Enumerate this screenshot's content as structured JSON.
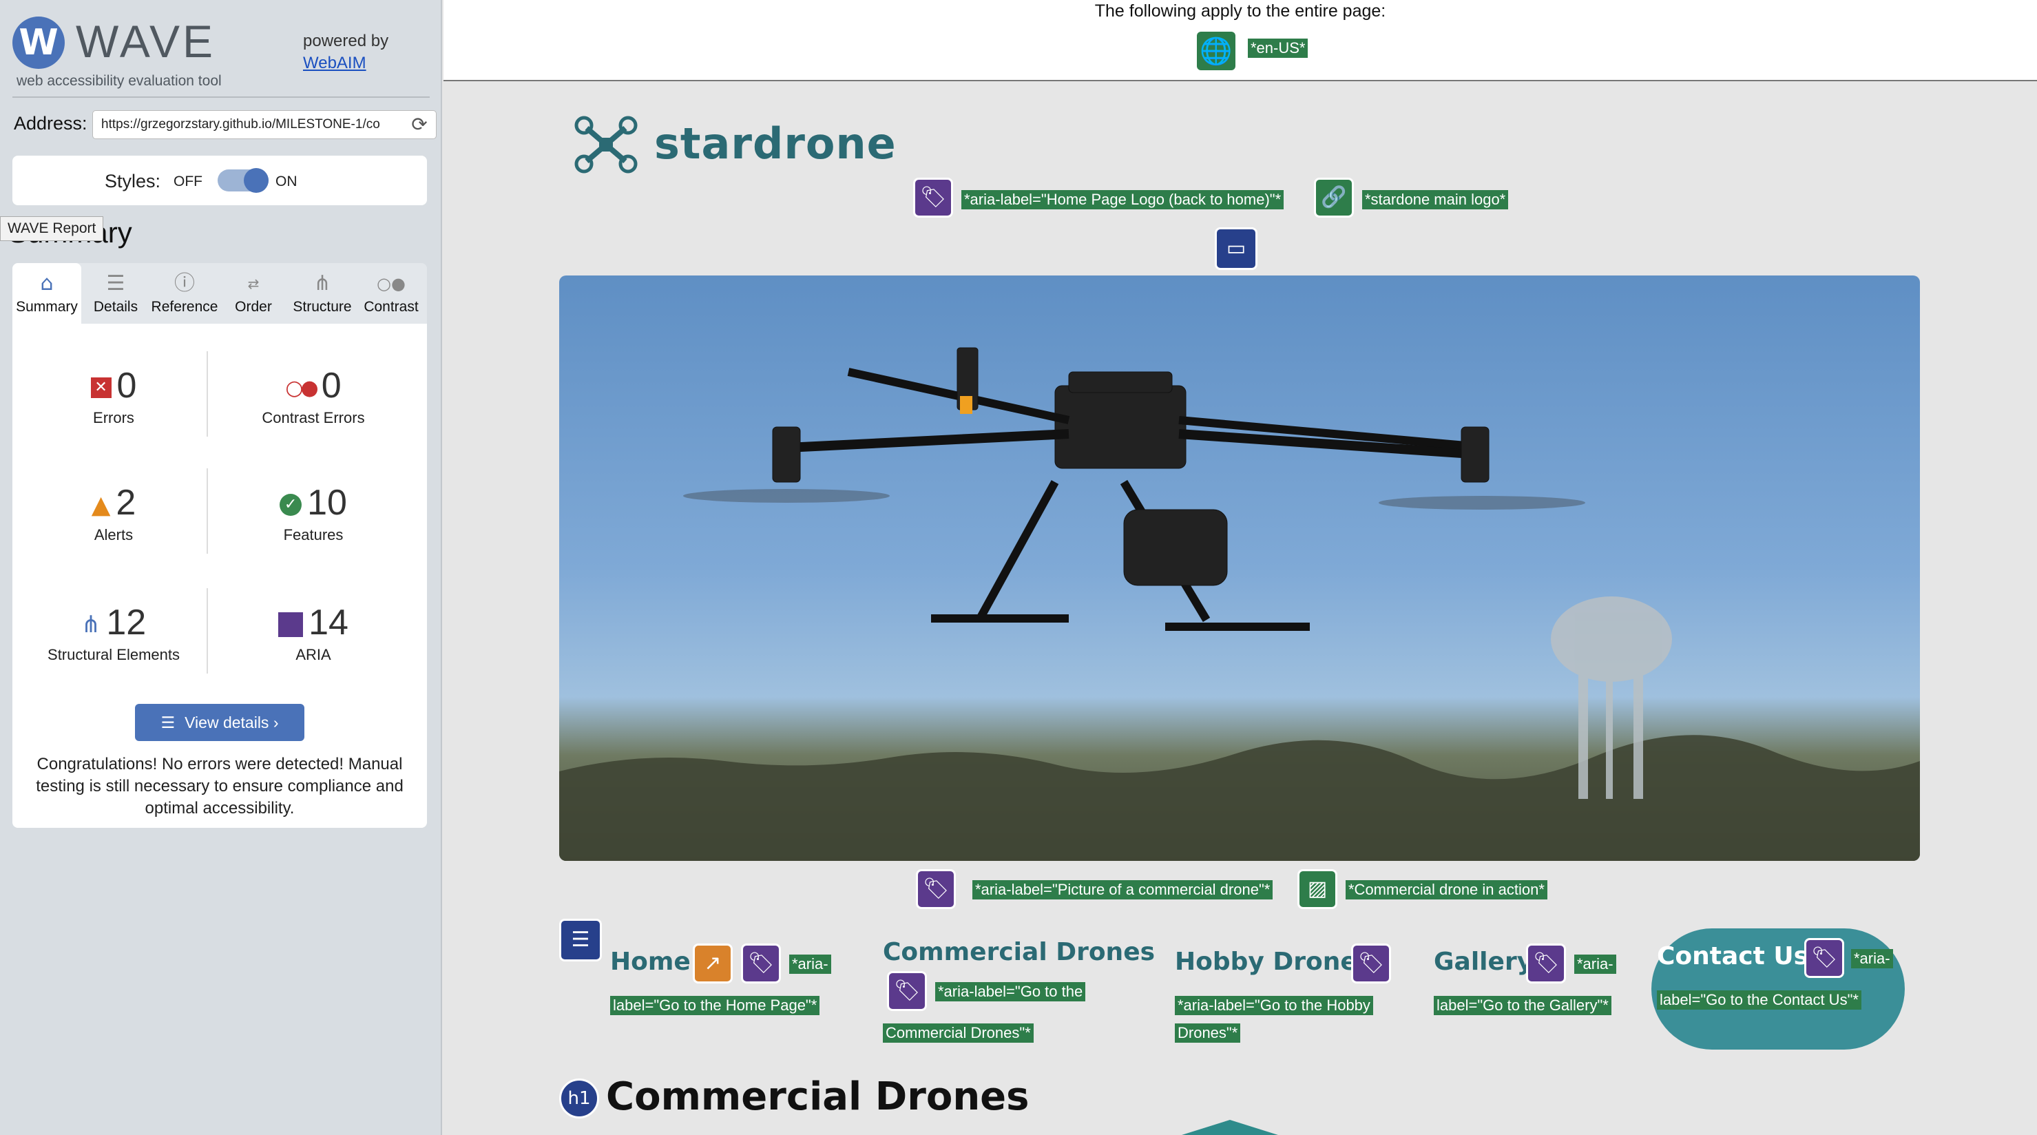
{
  "wave": {
    "logo_letter": "W",
    "logo_word": "WAVE",
    "tagline": "web accessibility evaluation tool",
    "powered_by": "powered by",
    "webaim_link": "WebAIM",
    "address_label": "Address:",
    "address_value": "https://grzegorzstary.github.io/MILESTONE-1/co",
    "styles_label": "Styles:",
    "styles_off": "OFF",
    "styles_on": "ON",
    "tooltip": "WAVE Report",
    "summary_heading": "Summary",
    "tabs": [
      {
        "label": "Summary",
        "icon": "home-icon"
      },
      {
        "label": "Details",
        "icon": "list-icon"
      },
      {
        "label": "Reference",
        "icon": "info-icon"
      },
      {
        "label": "Order",
        "icon": "order-icon"
      },
      {
        "label": "Structure",
        "icon": "structure-icon"
      },
      {
        "label": "Contrast",
        "icon": "contrast-icon"
      }
    ],
    "stats": {
      "errors": {
        "value": "0",
        "label": "Errors"
      },
      "contrast": {
        "value": "0",
        "label": "Contrast Errors"
      },
      "alerts": {
        "value": "2",
        "label": "Alerts"
      },
      "features": {
        "value": "10",
        "label": "Features"
      },
      "structural": {
        "value": "12",
        "label": "Structural Elements"
      },
      "aria": {
        "value": "14",
        "label": "ARIA"
      }
    },
    "view_details": "View details ›",
    "congrats": "Congratulations! No errors were detected! Manual testing is still necessary to ensure compliance and optimal accessibility."
  },
  "page": {
    "banner_text": "The following apply to the entire page:",
    "lang_tag": "*en-US*",
    "brand": "stardrone",
    "logo_aria_tag": "*aria-label=\"Home Page Logo (back to home)\"*",
    "logo_alt_tag": "*stardone main logo*",
    "hero_aria_tag": "*aria-label=\"Picture of a commercial drone\"*",
    "hero_alt_tag": "*Commercial drone in action*",
    "nav": {
      "home": "Home",
      "home_tag_1": "*aria-",
      "home_tag_2": "label=\"Go to the Home Page\"*",
      "commercial": "Commercial Drones",
      "commercial_tag_1": "*aria-label=\"Go to the",
      "commercial_tag_2": "Commercial Drones\"*",
      "hobby": "Hobby Drones",
      "hobby_tag_1": "*aria-label=\"Go to the Hobby",
      "hobby_tag_2": "Drones\"*",
      "gallery": "Gallery",
      "gallery_tag_1": "*aria-",
      "gallery_tag_2": "label=\"Go to the Gallery\"*",
      "contact": "Contact Us!",
      "contact_tag_1": "*aria-",
      "contact_tag_2": "label=\"Go to the Contact Us\"*"
    },
    "h1_badge": "h1",
    "h1": "Commercial Drones"
  },
  "colors": {
    "wave_blue": "#4a72b8",
    "feature_green": "#2e7d4a",
    "aria_purple": "#5b3a8c",
    "structure_navy": "#27408b",
    "brand_teal": "#2b6a74",
    "contact_teal": "#3b8f98"
  }
}
